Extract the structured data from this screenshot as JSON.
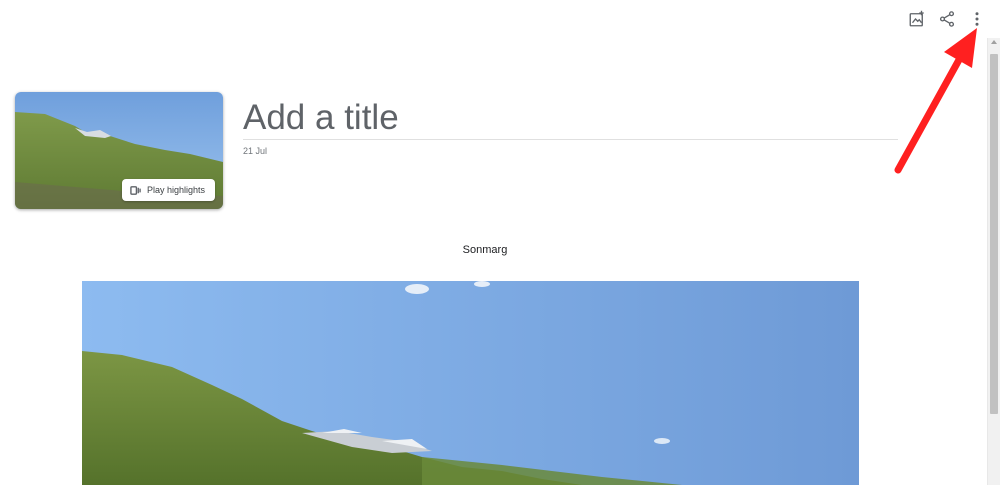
{
  "toolbar": {
    "icons": [
      "add-photo-icon",
      "share-icon",
      "more-options-icon"
    ]
  },
  "album": {
    "title_placeholder": "Add a title",
    "title_value": "",
    "date": "21 Jul",
    "play_highlights_label": "Play highlights",
    "location_caption": "Sonmarg"
  },
  "colors": {
    "sky": "#8db6e4",
    "grass": "#6f8f3e",
    "annotation_arrow": "#ff2020"
  }
}
